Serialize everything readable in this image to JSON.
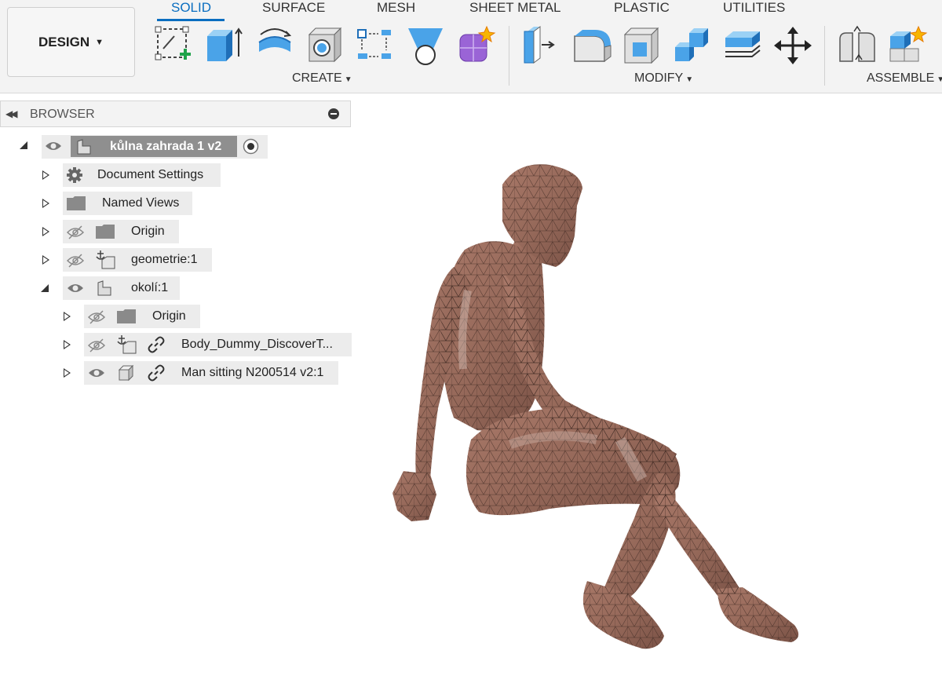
{
  "workspace": {
    "label": "DESIGN"
  },
  "tabs": [
    "SOLID",
    "SURFACE",
    "MESH",
    "SHEET METAL",
    "PLASTIC",
    "UTILITIES"
  ],
  "groups": {
    "create": "CREATE",
    "modify": "MODIFY",
    "assemble": "ASSEMBLE"
  },
  "tools": {
    "create": [
      "create-sketch-icon",
      "extrude-icon",
      "revolve-icon",
      "hole-icon",
      "pattern-icon",
      "loft-icon",
      "create-form-icon"
    ],
    "modify": [
      "press-pull-icon",
      "fillet-icon",
      "shell-icon",
      "combine-icon",
      "offset-face-icon",
      "move-icon"
    ],
    "assemble": [
      "joint-icon",
      "new-component-icon"
    ]
  },
  "browser": {
    "title": "BROWSER",
    "root": "kůlna zahrada 1 v2",
    "items": [
      {
        "label": "Document Settings"
      },
      {
        "label": "Named Views"
      },
      {
        "label": "Origin"
      },
      {
        "label": "geometrie:1"
      },
      {
        "label": "okolí:1"
      },
      {
        "label": "Origin"
      },
      {
        "label": "Body_Dummy_DiscoverT..."
      },
      {
        "label": "Man sitting N200514 v2:1"
      }
    ]
  },
  "colors": {
    "accent": "#0a6ec0",
    "mesh": "#9c6e5f",
    "panel": "#f3f3f3"
  }
}
